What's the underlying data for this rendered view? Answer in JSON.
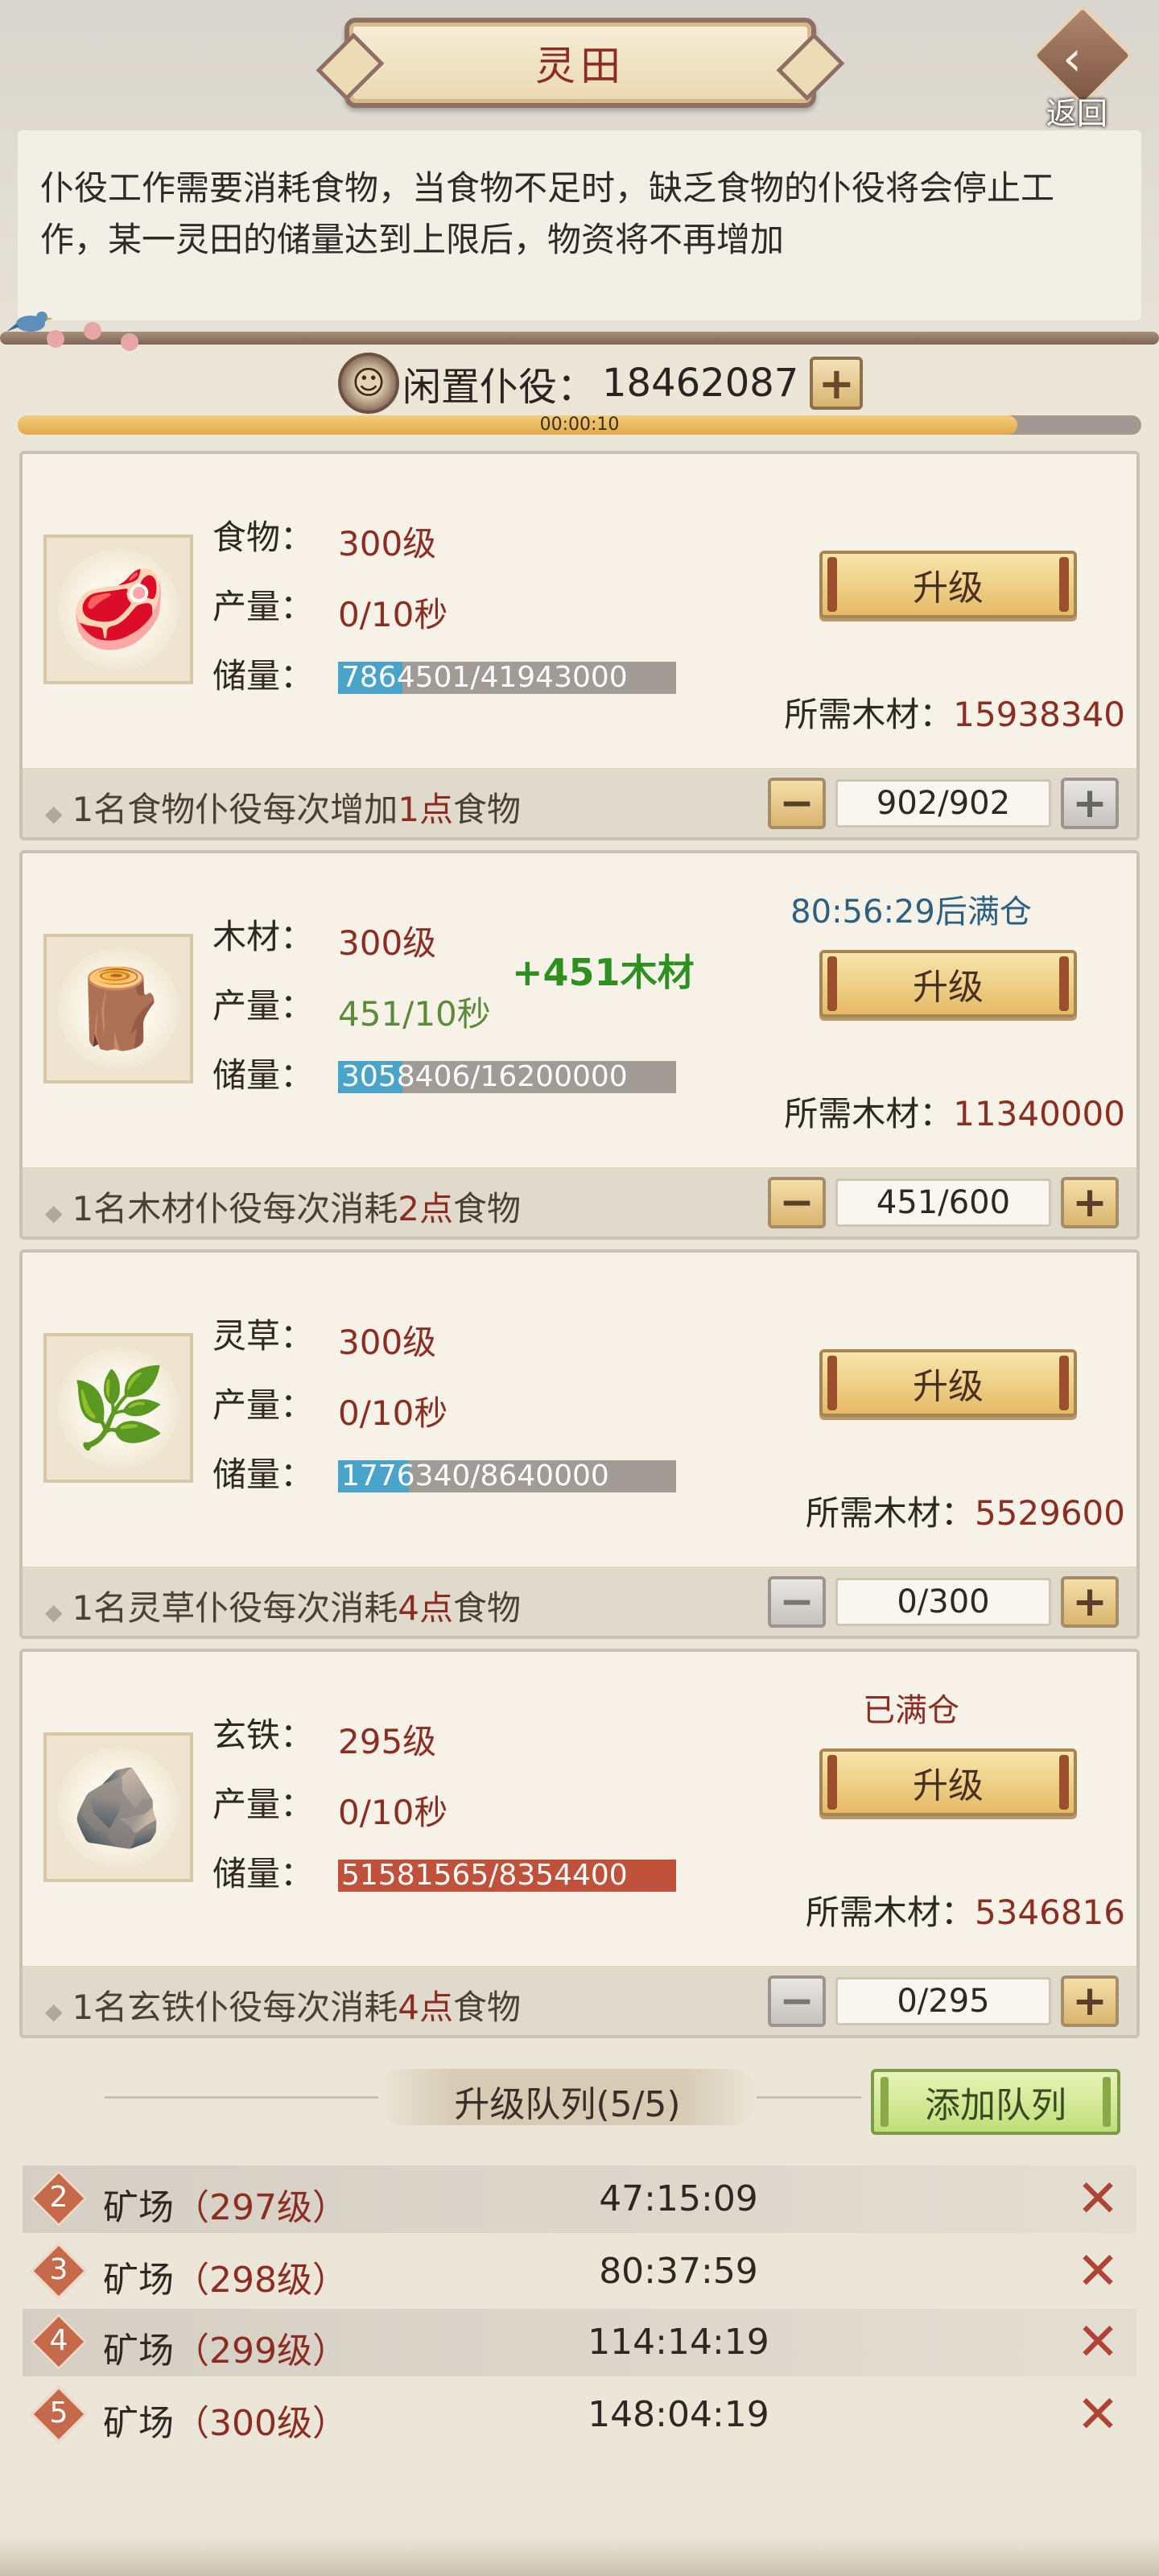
{
  "header": {
    "title": "灵田",
    "back_label": "返回"
  },
  "notice": "仆役工作需要消耗食物，当食物不足时，缺乏食物的仆役将会停止工作，某一灵田的储量达到上限后，物资将不再增加",
  "idle": {
    "label": "闲置仆役：",
    "value": "18462087",
    "plus": "+"
  },
  "timer": {
    "text": "00:00:10",
    "progress": 0.89
  },
  "labels": {
    "production": "产量：",
    "storage": "储量：",
    "cost_label": "所需木材：",
    "upgrade": "升级"
  },
  "fields": [
    {
      "name": "食物：",
      "icon": "meat-icon",
      "level": "300级",
      "rate": "0/10秒",
      "stock": "7864501/41943000",
      "stock_fraction": 0.19,
      "status": "",
      "cost": "15938340",
      "footer_pre": "1名食物仆役每次增加",
      "footer_hl": "1点",
      "footer_post": "食物",
      "stepper": "902/902"
    },
    {
      "name": "木材：",
      "icon": "wood-icon",
      "level": "300级",
      "rate": "451/10秒",
      "stock": "3058406/16200000",
      "stock_fraction": 0.19,
      "status": "80:56:29后满仓",
      "cost": "11340000",
      "floating_gain": "+451木材",
      "footer_pre": "1名木材仆役每次消耗",
      "footer_hl": "2点",
      "footer_post": "食物",
      "stepper": "451/600"
    },
    {
      "name": "灵草：",
      "icon": "herb-icon",
      "level": "300级",
      "rate": "0/10秒",
      "stock": "1776340/8640000",
      "stock_fraction": 0.21,
      "status": "",
      "cost": "5529600",
      "footer_pre": "1名灵草仆役每次消耗",
      "footer_hl": "4点",
      "footer_post": "食物",
      "stepper": "0/300"
    },
    {
      "name": "玄铁：",
      "icon": "ore-icon",
      "level": "295级",
      "rate": "0/10秒",
      "stock": "51581565/8354400",
      "stock_fraction": 1.0,
      "status": "已满仓",
      "cost": "5346816",
      "footer_pre": "1名玄铁仆役每次消耗",
      "footer_hl": "4点",
      "footer_post": "食物",
      "stepper": "0/295"
    }
  ],
  "queue": {
    "title": "升级队列(5/5)",
    "add_button": "添加队列",
    "items": [
      {
        "num": "2",
        "name": "矿场",
        "level": "（297级）",
        "time": "47:15:09"
      },
      {
        "num": "3",
        "name": "矿场",
        "level": "（298级）",
        "time": "80:37:59"
      },
      {
        "num": "4",
        "name": "矿场",
        "level": "（299级）",
        "time": "114:14:19"
      },
      {
        "num": "5",
        "name": "矿场",
        "level": "（300级）",
        "time": "148:04:19"
      }
    ]
  },
  "colors": {
    "accent_red": "#8b2d22",
    "progress_blue": "#4aa3c9",
    "full_red": "#c0523c",
    "green": "#5d8a3a"
  }
}
